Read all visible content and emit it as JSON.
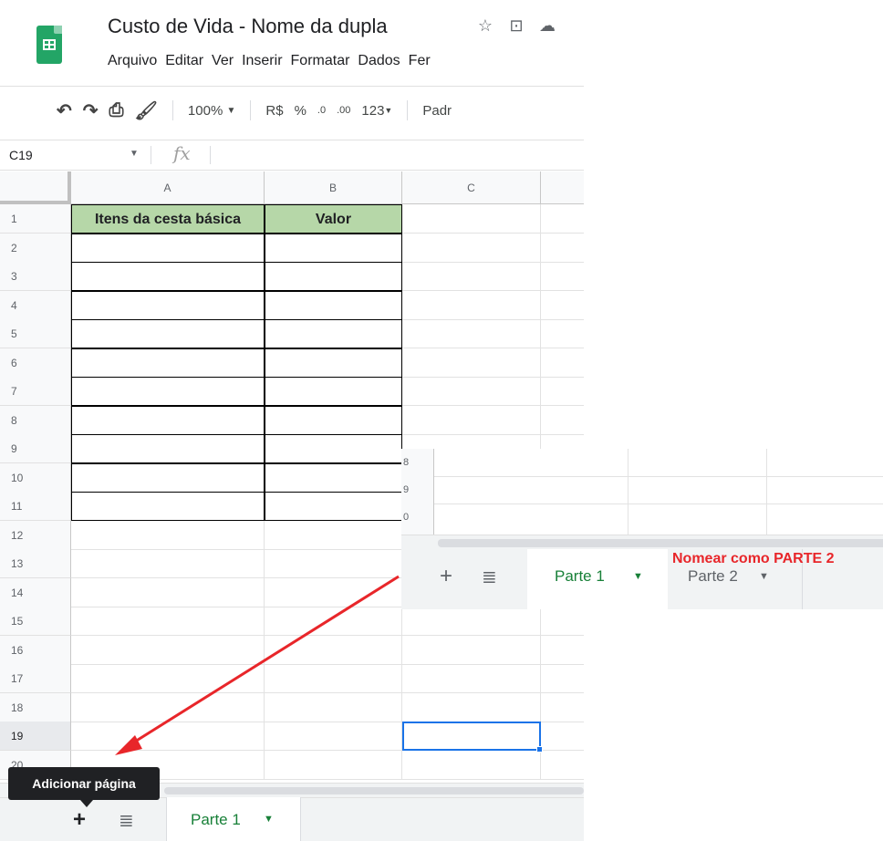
{
  "document": {
    "title": "Custo de Vida - Nome da dupla",
    "title_icons": [
      "star-icon",
      "move-to-folder-icon",
      "cloud-status-icon"
    ]
  },
  "menu": [
    "Arquivo",
    "Editar",
    "Ver",
    "Inserir",
    "Formatar",
    "Dados",
    "Fer"
  ],
  "toolbar": {
    "undo_icon": "undo-icon",
    "redo_icon": "redo-icon",
    "print_icon": "print-icon",
    "paint_format_icon": "paint-format-icon",
    "zoom": "100%",
    "currency": "R$",
    "percent": "%",
    "decrease_decimals": ".0",
    "increase_decimals": ".00",
    "more_formats": "123",
    "font": "Padr"
  },
  "formula_bar": {
    "name_box": "C19",
    "fx_label": "fx"
  },
  "sheet": {
    "columns": [
      "A",
      "B",
      "C"
    ],
    "rows": [
      "1",
      "2",
      "3",
      "4",
      "5",
      "6",
      "7",
      "8",
      "9",
      "10",
      "11",
      "12",
      "13",
      "14",
      "15",
      "16",
      "17",
      "18",
      "19",
      "20"
    ],
    "header_cells": [
      "Itens da cesta básica",
      "Valor"
    ],
    "selected_cell": "C19",
    "header_fill": "#b6d7a8",
    "selection_color": "#1a73e8"
  },
  "sheet_bar": {
    "tabs": [
      {
        "label": "Parte 1",
        "active": true
      }
    ],
    "add_icon": "plus-icon",
    "all_sheets_icon": "list-icon",
    "active_color": "#188038"
  },
  "tooltip": {
    "text": "Adicionar página"
  },
  "overlay": {
    "row_labels": [
      "8",
      "9",
      "0"
    ],
    "tabs": [
      {
        "label": "Parte 1",
        "active": true
      },
      {
        "label": "Parte 2",
        "active": false
      }
    ],
    "annotation": "Nomear como PARTE 2",
    "annotation_color": "#e8262a",
    "arrow_color": "#e8262a"
  }
}
